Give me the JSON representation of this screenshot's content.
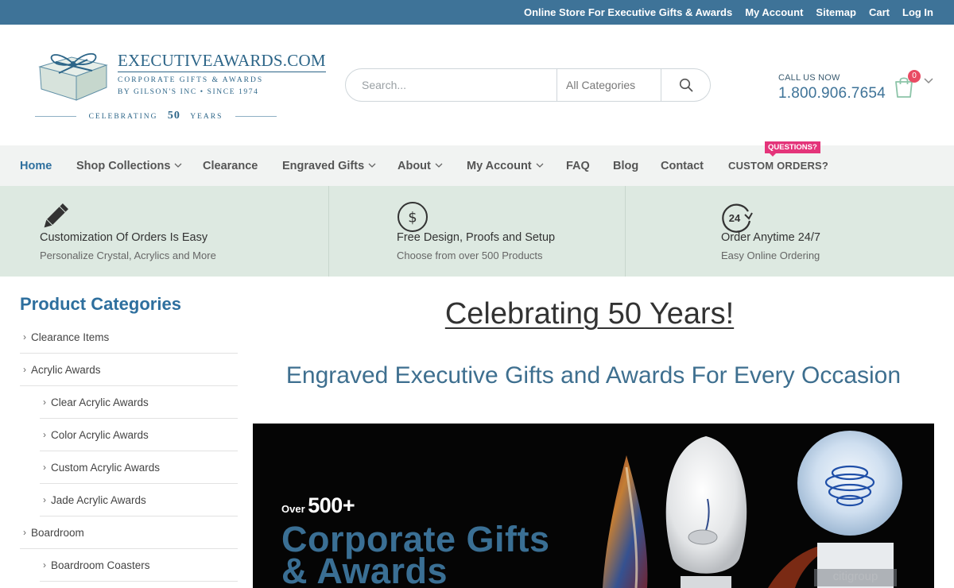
{
  "topbar": {
    "links": [
      "Online Store For Executive Gifts & Awards",
      "My Account",
      "Sitemap",
      "Cart",
      "Log In"
    ]
  },
  "logo": {
    "brand": "EXECUTIVEAWARDS.COM",
    "line1": "CORPORATE GIFTS & AWARDS",
    "line2": "BY GILSON'S INC • SINCE 1974",
    "celebrating": "CELEBRATING",
    "years_num": "50",
    "years": "YEARS"
  },
  "search": {
    "placeholder": "Search...",
    "category": "All Categories",
    "button_icon": "search-icon"
  },
  "contact": {
    "label": "CALL US NOW",
    "phone": "1.800.906.7654"
  },
  "cart": {
    "count": "0",
    "icon": "shopping-bag-icon"
  },
  "nav": {
    "items": [
      {
        "label": "Home",
        "active": true,
        "dropdown": false
      },
      {
        "label": "Shop Collections",
        "dropdown": true
      },
      {
        "label": "Clearance",
        "dropdown": false
      },
      {
        "label": "Engraved Gifts",
        "dropdown": true
      },
      {
        "label": "About",
        "dropdown": true
      },
      {
        "label": "My Account",
        "dropdown": true
      },
      {
        "label": "FAQ",
        "dropdown": false
      },
      {
        "label": "Blog",
        "dropdown": false
      },
      {
        "label": "Contact",
        "dropdown": false
      },
      {
        "label": "CUSTOM ORDERS?",
        "dropdown": false
      }
    ],
    "tag": "QUESTIONS?"
  },
  "features": [
    {
      "icon": "pencil-icon",
      "title": "Customization Of Orders Is Easy",
      "desc": "Personalize Crystal, Acrylics and More"
    },
    {
      "icon": "dollar-icon",
      "title": "Free Design, Proofs and Setup",
      "desc": "Choose from over 500 Products"
    },
    {
      "icon": "clock-24-icon",
      "icon_text": "24",
      "title": "Order Anytime 24/7",
      "desc": "Easy Online Ordering"
    }
  ],
  "sidebar": {
    "title": "Product Categories",
    "items": [
      {
        "label": "Clearance Items",
        "level": 0
      },
      {
        "label": "Acrylic Awards",
        "level": 0
      },
      {
        "label": "Clear Acrylic Awards",
        "level": 1
      },
      {
        "label": "Color Acrylic Awards",
        "level": 1
      },
      {
        "label": "Custom Acrylic Awards",
        "level": 1
      },
      {
        "label": "Jade Acrylic Awards",
        "level": 1
      },
      {
        "label": "Boardroom",
        "level": 0
      },
      {
        "label": "Boardroom Coasters",
        "level": 1
      }
    ]
  },
  "main": {
    "heading": "Celebrating 50 Years!",
    "subheading": "Engraved Executive Gifts and Awards For Every Occasion",
    "banner": {
      "over": "Over",
      "count": "500+",
      "line1": "Corporate Gifts",
      "line2": "& Awards",
      "globe_brand": "citigroup"
    }
  },
  "colors": {
    "topbar": "#3e7398",
    "accent": "#2e6f9e",
    "feature_bg": "#dde9e1",
    "nav_bg": "#f1f3f2",
    "badge": "#e94b63",
    "tag": "#e4347a"
  }
}
